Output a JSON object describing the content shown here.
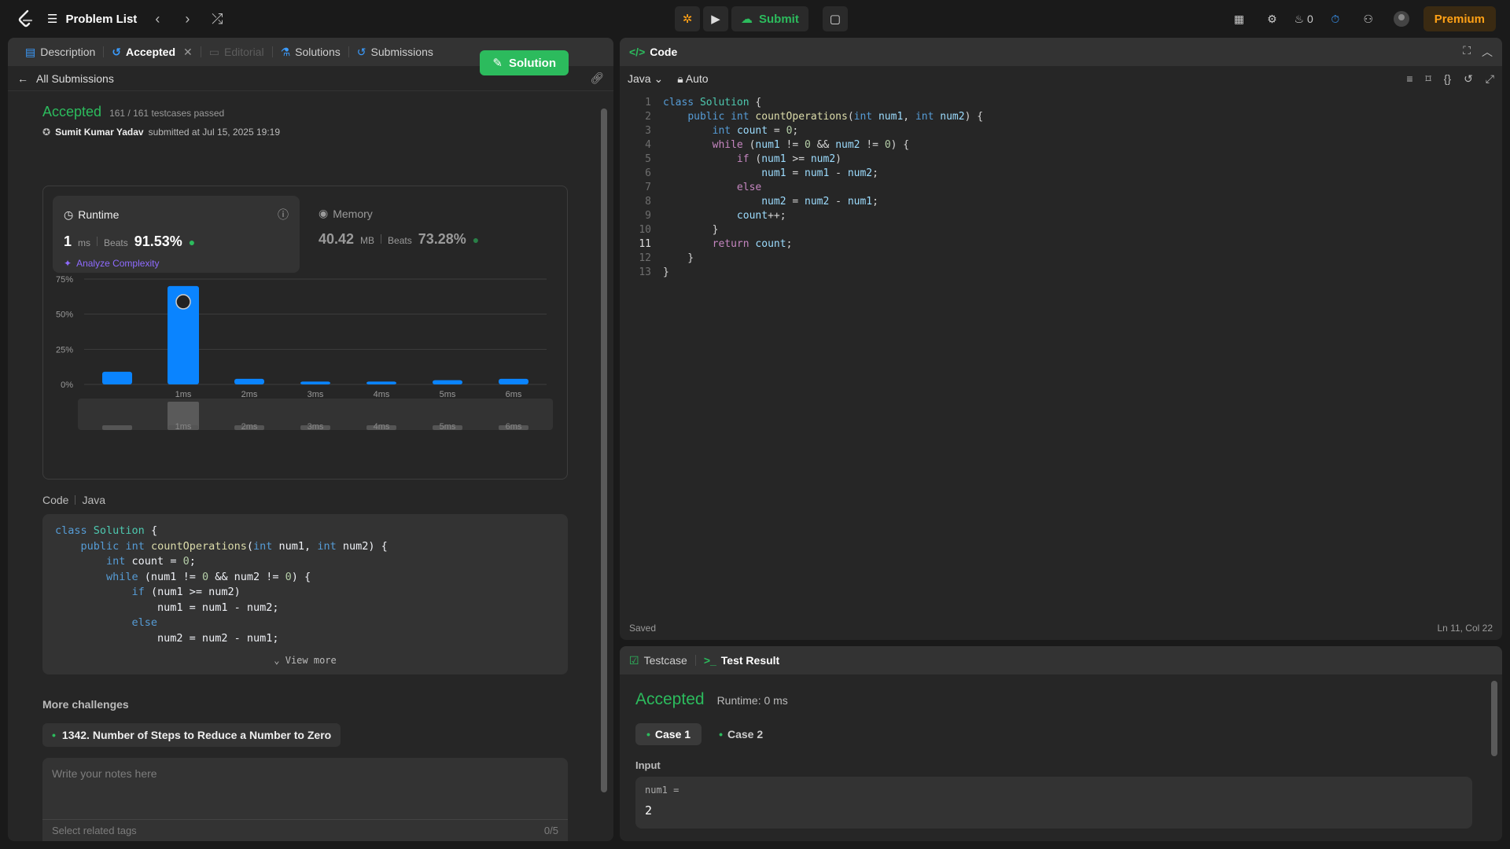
{
  "topbar": {
    "problem_list": "Problem List",
    "submit": "Submit",
    "streak": "0",
    "premium": "Premium"
  },
  "left": {
    "tabs": [
      {
        "label": "Description"
      },
      {
        "label": "Accepted"
      },
      {
        "label": "Editorial"
      },
      {
        "label": "Solutions"
      },
      {
        "label": "Submissions"
      }
    ],
    "back_label": "All Submissions",
    "status": "Accepted",
    "testcases": "161 / 161 testcases passed",
    "user": "Sumit Kumar Yadav",
    "submitted_at": "submitted at Jul 15, 2025 19:19",
    "solution_btn": "Solution",
    "runtime": {
      "title": "Runtime",
      "value": "1",
      "unit": "ms",
      "beats_label": "Beats",
      "beats": "91.53%"
    },
    "memory": {
      "title": "Memory",
      "value": "40.42",
      "unit": "MB",
      "beats_label": "Beats",
      "beats": "73.28%"
    },
    "analyze": "Analyze Complexity",
    "code_label": "Code",
    "code_lang": "Java",
    "view_more": "View more",
    "more_challenges": "More challenges",
    "challenge": "1342. Number of Steps to Reduce a Number to Zero",
    "notes_placeholder": "Write your notes here",
    "tags_placeholder": "Select related tags",
    "tags_count": "0/5"
  },
  "chart_data": {
    "type": "bar",
    "categories": [
      "",
      "1ms",
      "2ms",
      "3ms",
      "4ms",
      "5ms",
      "6ms"
    ],
    "values": [
      9,
      70,
      4,
      2,
      2,
      3,
      4
    ],
    "ylim": [
      0,
      75
    ],
    "yticks": [
      "75%",
      "50%",
      "25%",
      "0%"
    ],
    "ytick_values": [
      75,
      50,
      25,
      0
    ],
    "highlight": "1ms",
    "accent": "#0a84ff"
  },
  "code_panel": {
    "title": "Code",
    "lang": "Java",
    "mode": "Auto",
    "saved": "Saved",
    "cursor": "Ln 11, Col 22"
  },
  "result": {
    "tabs": [
      "Testcase",
      "Test Result"
    ],
    "status": "Accepted",
    "runtime": "Runtime: 0 ms",
    "cases": [
      "Case 1",
      "Case 2"
    ],
    "input_label": "Input",
    "var": "num1 =",
    "value": "2"
  },
  "colors": {
    "accent_green": "#2cbb5d",
    "premium": "#ffa116",
    "bar_blue": "#0a84ff"
  }
}
